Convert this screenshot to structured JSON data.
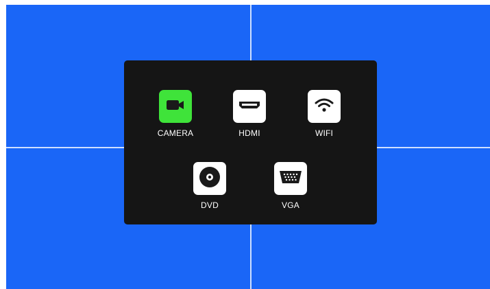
{
  "colors": {
    "background": "#1a66f7",
    "panel": "#151515",
    "selected_tile": "#3fe33a",
    "tile": "#ffffff",
    "icon": "#1a1a1a",
    "label": "#ffffff"
  },
  "source_menu": {
    "selected": "CAMERA",
    "items": [
      {
        "label": "CAMERA",
        "icon": "video-camera-icon",
        "selected": true
      },
      {
        "label": "HDMI",
        "icon": "hdmi-port-icon",
        "selected": false
      },
      {
        "label": "WIFI",
        "icon": "wifi-icon",
        "selected": false
      },
      {
        "label": "DVD",
        "icon": "disc-icon",
        "selected": false
      },
      {
        "label": "VGA",
        "icon": "vga-port-icon",
        "selected": false
      }
    ]
  }
}
